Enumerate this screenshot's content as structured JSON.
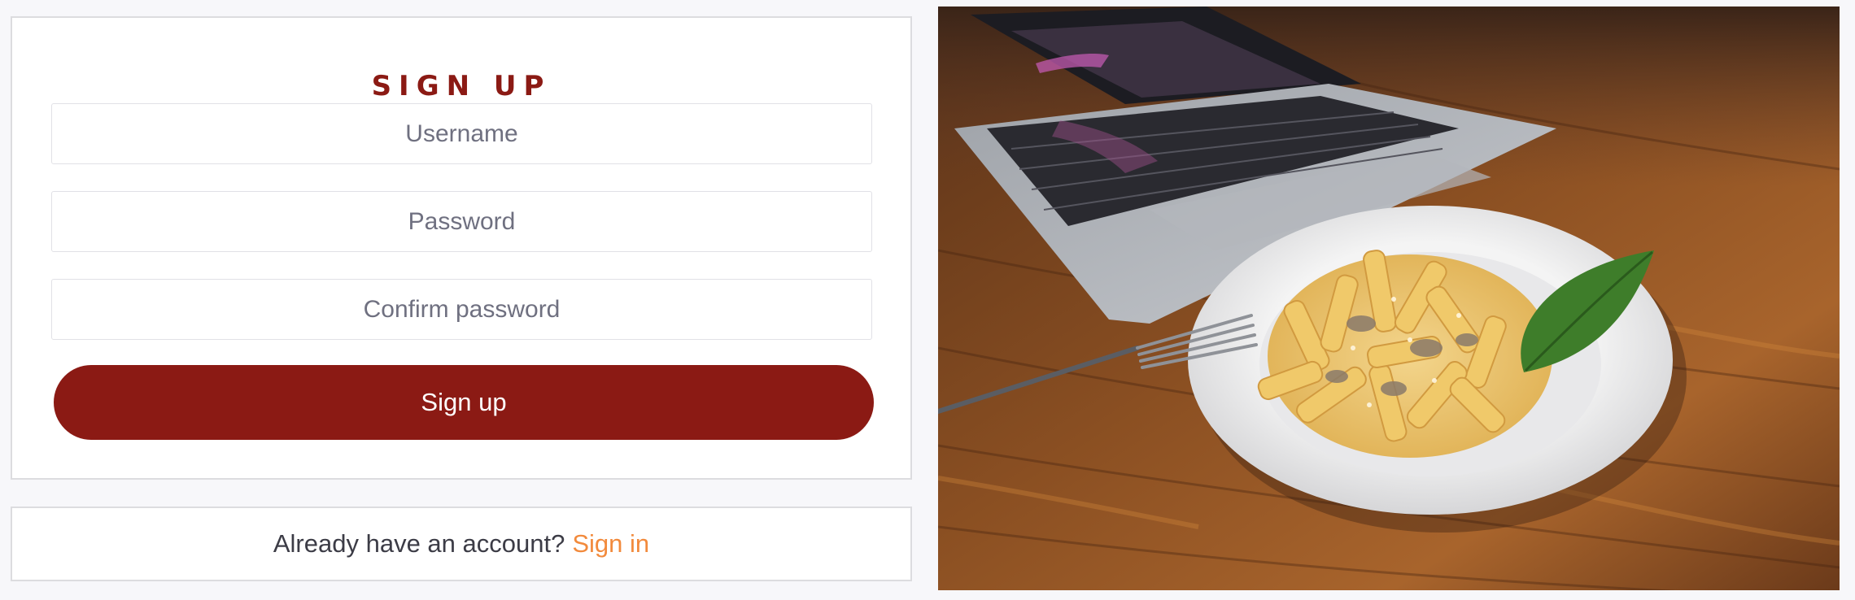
{
  "signup": {
    "title": "SIGN UP",
    "username_placeholder": "Username",
    "password_placeholder": "Password",
    "confirm_placeholder": "Confirm password",
    "submit_label": "Sign up"
  },
  "signin": {
    "prompt": "Already have an account?",
    "link_label": "Sign in"
  },
  "colors": {
    "brand": "#8b1a14",
    "link": "#f28a3c",
    "background": "#f7f7fa"
  },
  "hero_image": {
    "subject": "plate of penne pasta with basil next to a laptop on a wooden table"
  }
}
